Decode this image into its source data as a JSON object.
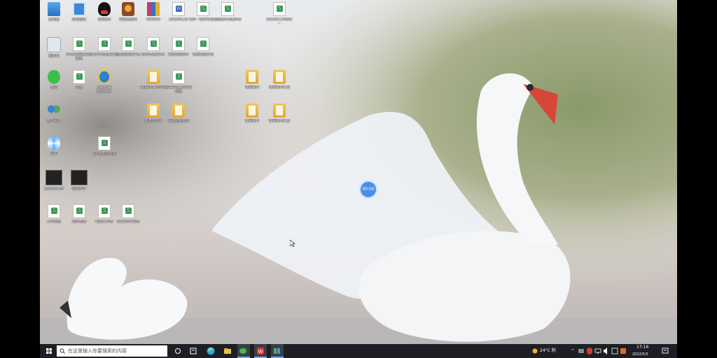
{
  "desktop": {
    "icons": [
      {
        "label": "此电脑",
        "glyph": "pc"
      },
      {
        "label": "控制面板",
        "glyph": "panel"
      },
      {
        "label": "腾讯QQ",
        "glyph": "qq"
      },
      {
        "label": "网易云游戏",
        "glyph": "app"
      },
      {
        "label": "WinRAR",
        "glyph": "rar"
      },
      {
        "label": "2022年工作",
        "glyph": "word"
      },
      {
        "label": "课件···数学作业一",
        "glyph": "sheet"
      },
      {
        "label": "数据统计表格计算",
        "glyph": "sheet"
      },
      {
        "label": "2022年工作统计···",
        "glyph": "sheet"
      },
      {
        "label": "回收站",
        "glyph": "bin"
      },
      {
        "label": "2022年项目分析报告",
        "glyph": "sheet"
      },
      {
        "label": "工作计划表格汇总",
        "glyph": "sheet"
      },
      {
        "label": "班级成绩统计表",
        "glyph": "sheet"
      },
      {
        "label": "统计表格2022",
        "glyph": "sheet"
      },
      {
        "label": "月度数据统计",
        "glyph": "sheet"
      },
      {
        "label": "课题总结计划",
        "glyph": "sheet"
      },
      {
        "label": "微信",
        "glyph": "wechat"
      },
      {
        "label": "文档",
        "glyph": "sheet"
      },
      {
        "label": "Internet Explorer",
        "glyph": "ie"
      },
      {
        "label": "2022年工作计划",
        "glyph": "folder"
      },
      {
        "label": "2022年工作汇报总结",
        "glyph": "sheet"
      },
      {
        "label": "课程资料",
        "glyph": "folder"
      },
      {
        "label": "课程资料汇总",
        "glyph": "folder"
      },
      {
        "label": "用户设置",
        "glyph": "people"
      },
      {
        "label": "新建文件夹",
        "glyph": "folder"
      },
      {
        "label": "会议纪要整理",
        "glyph": "folder"
      },
      {
        "label": "课程资料",
        "glyph": "folder"
      },
      {
        "label": "课程资料汇总",
        "glyph": "folder"
      },
      {
        "label": "风车",
        "glyph": "pinwheel"
      },
      {
        "label": "1年级数学作业",
        "glyph": "sheet"
      },
      {
        "label": "2022年工作",
        "glyph": "video"
      },
      {
        "label": "视频文件",
        "glyph": "video"
      },
      {
        "label": "工作总结",
        "glyph": "sheet"
      },
      {
        "label": "统计表格",
        "glyph": "sheet"
      },
      {
        "label": "新建工作表",
        "glyph": "sheet"
      },
      {
        "label": "2022年计划表",
        "glyph": "sheet"
      }
    ]
  },
  "recording_timer": "00:00",
  "taskbar": {
    "search_placeholder": "在这里输入你要搜索的内容",
    "weather": "24°C 阴",
    "time": "17:16",
    "date": "2022/5/3"
  },
  "colors": {
    "taskbar": "#1d1f24",
    "accent": "#4a8ee8"
  }
}
